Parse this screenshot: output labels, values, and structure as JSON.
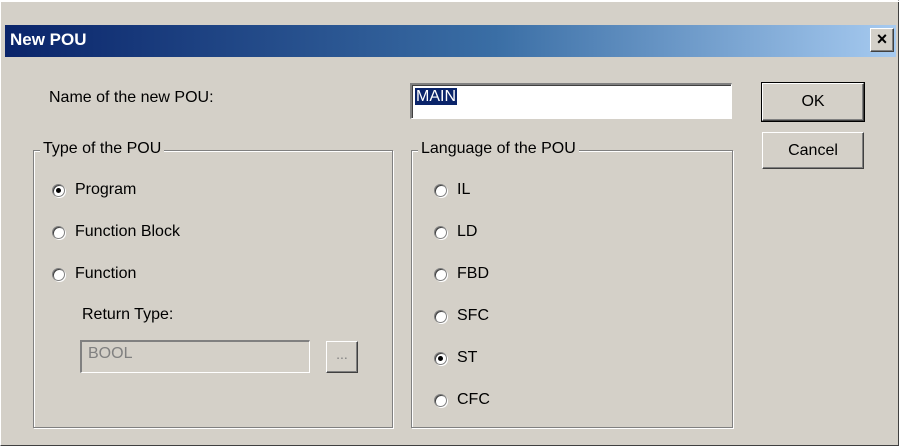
{
  "window": {
    "title": "New POU",
    "close_label": "×"
  },
  "name_field": {
    "label": "Name of the new POU:",
    "value": "MAIN"
  },
  "buttons": {
    "ok": "OK",
    "cancel": "Cancel",
    "browse": "..."
  },
  "type_group": {
    "legend": "Type of the POU",
    "options": [
      {
        "label": "Program",
        "checked": true
      },
      {
        "label": "Function Block",
        "checked": false
      },
      {
        "label": "Function",
        "checked": false
      }
    ],
    "return_type_label": "Return Type:",
    "return_type_value": "BOOL"
  },
  "language_group": {
    "legend": "Language of the POU",
    "options": [
      {
        "label": "IL",
        "checked": false
      },
      {
        "label": "LD",
        "checked": false
      },
      {
        "label": "FBD",
        "checked": false
      },
      {
        "label": "SFC",
        "checked": false
      },
      {
        "label": "ST",
        "checked": true
      },
      {
        "label": "CFC",
        "checked": false
      }
    ]
  }
}
